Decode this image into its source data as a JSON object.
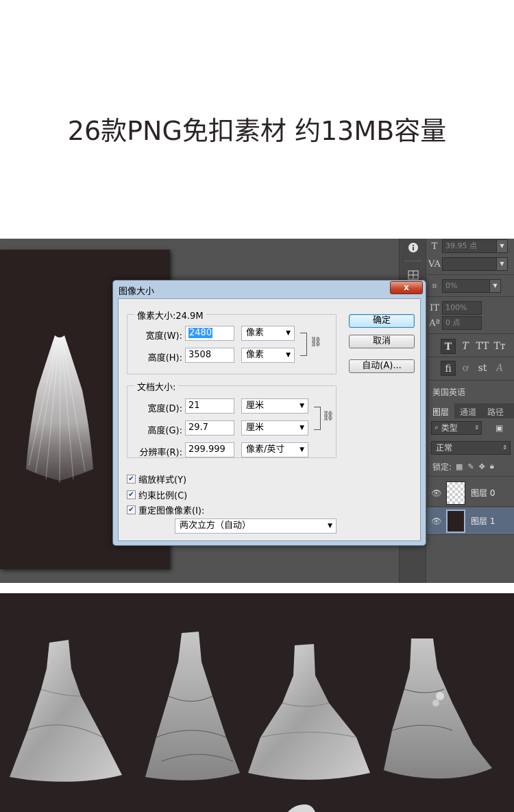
{
  "headline": "26款PNG免扣素材  约13MB容量",
  "dialog": {
    "title": "图像大小",
    "close": "x",
    "pixel_dimensions": {
      "title": "像素大小:24.9M",
      "width_label": "宽度(W):",
      "width_value": "2480",
      "width_unit": "像素",
      "height_label": "高度(H):",
      "height_value": "3508",
      "height_unit": "像素"
    },
    "document_size": {
      "title": "文档大小:",
      "width_label": "宽度(D):",
      "width_value": "21",
      "width_unit": "厘米",
      "height_label": "高度(G):",
      "height_value": "29.7",
      "height_unit": "厘米",
      "resolution_label": "分辨率(R):",
      "resolution_value": "299.999",
      "resolution_unit": "像素/英寸"
    },
    "checkboxes": [
      {
        "label": "缩放样式(Y)",
        "checked": true
      },
      {
        "label": "约束比例(C)",
        "checked": true
      },
      {
        "label": "重定图像像素(I):",
        "checked": true
      }
    ],
    "resample_method": "两次立方（自动）",
    "buttons": {
      "ok": "确定",
      "cancel": "取消",
      "auto": "自动(A)..."
    }
  },
  "character_panel": {
    "size_value": "39.95 点",
    "tracking_value": "0%",
    "vscale_value": "100%",
    "baseline_value": "0 点",
    "style_buttons": [
      "T",
      "T",
      "TT",
      "Tт"
    ],
    "opentype_buttons": [
      "fi",
      "ơ",
      "st",
      "A"
    ],
    "language": "美国英语"
  },
  "layers_panel": {
    "tabs": [
      "图层",
      "通道",
      "路径"
    ],
    "filter_label": "类型",
    "blend_mode": "正常",
    "lock_label": "锁定:",
    "layers": [
      {
        "name": "图层 0",
        "selected": false
      },
      {
        "name": "图层 1",
        "selected": true
      }
    ]
  },
  "colors": {
    "ps_background": "#535353",
    "canvas": "#2a2020",
    "dialog_frame": "#b9cde3",
    "selected_layer": "#5a6a80",
    "selection_highlight": "#3399ff"
  }
}
